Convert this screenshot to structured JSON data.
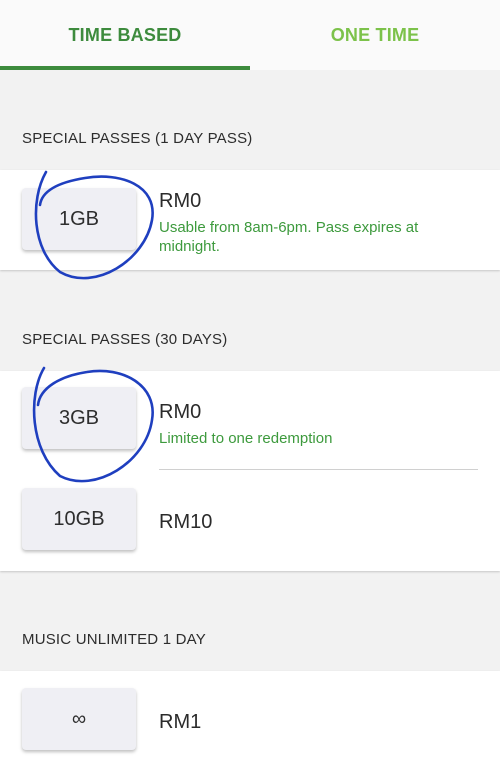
{
  "tabs": [
    {
      "label": "TIME BASED",
      "active": true
    },
    {
      "label": "ONE TIME",
      "active": false
    }
  ],
  "sections": {
    "day_pass": {
      "title": "SPECIAL PASSES (1 DAY PASS)",
      "items": [
        {
          "size": "1GB",
          "price": "RM0",
          "description": "Usable from 8am-6pm. Pass expires at midnight."
        }
      ]
    },
    "thirty_days": {
      "title": "SPECIAL PASSES (30 DAYS)",
      "items": [
        {
          "size": "3GB",
          "price": "RM0",
          "description": "Limited to one redemption"
        },
        {
          "size": "10GB",
          "price": "RM10"
        }
      ]
    },
    "music": {
      "title": "MUSIC UNLIMITED 1 DAY",
      "items": [
        {
          "size": "∞",
          "price": "RM1"
        }
      ]
    }
  },
  "colors": {
    "tab_active": "#3d8b3d",
    "tab_inactive": "#7cc24a",
    "description_text": "#3d9a3d",
    "annotation_ink": "#1f3fbf"
  }
}
